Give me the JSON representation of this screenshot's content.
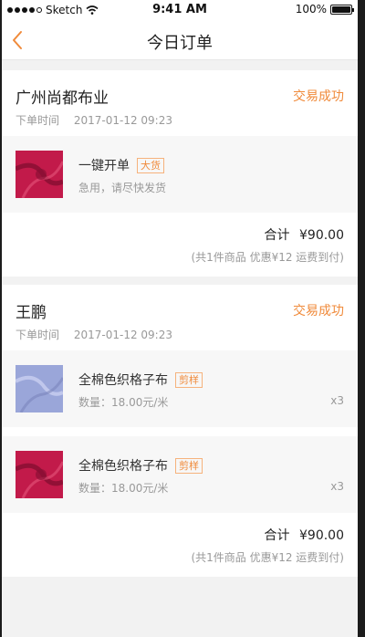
{
  "status_bar": {
    "carrier": "Sketch",
    "time": "9:41 AM",
    "battery": "100%"
  },
  "nav": {
    "title": "今日订单"
  },
  "orders": [
    {
      "shop": "广州尚都布业",
      "status": "交易成功",
      "time_label": "下单时间",
      "time": "2017-01-12  09:23",
      "items": [
        {
          "name": "一键开单",
          "tag": "大货",
          "sub": "急用，请尽快发货",
          "qty": "",
          "color": "#c21a4a"
        }
      ],
      "total_label": "合计",
      "total": "¥90.00",
      "summary": "(共1件商品 优惠¥12 运费到付)"
    },
    {
      "shop": "王鹏",
      "status": "交易成功",
      "time_label": "下单时间",
      "time": "2017-01-12  09:23",
      "items": [
        {
          "name": "全棉色织格子布",
          "tag": "剪样",
          "sub": "数量：18.00元/米",
          "qty": "x3",
          "color": "#9aa6d9"
        },
        {
          "name": "全棉色织格子布",
          "tag": "剪样",
          "sub": "数量：18.00元/米",
          "qty": "x3",
          "color": "#c21a4a"
        }
      ],
      "total_label": "合计",
      "total": "¥90.00",
      "summary": "(共1件商品 优惠¥12 运费到付)"
    }
  ],
  "colors": {
    "accent": "#f08a3a",
    "background": "#f2f2f2"
  }
}
